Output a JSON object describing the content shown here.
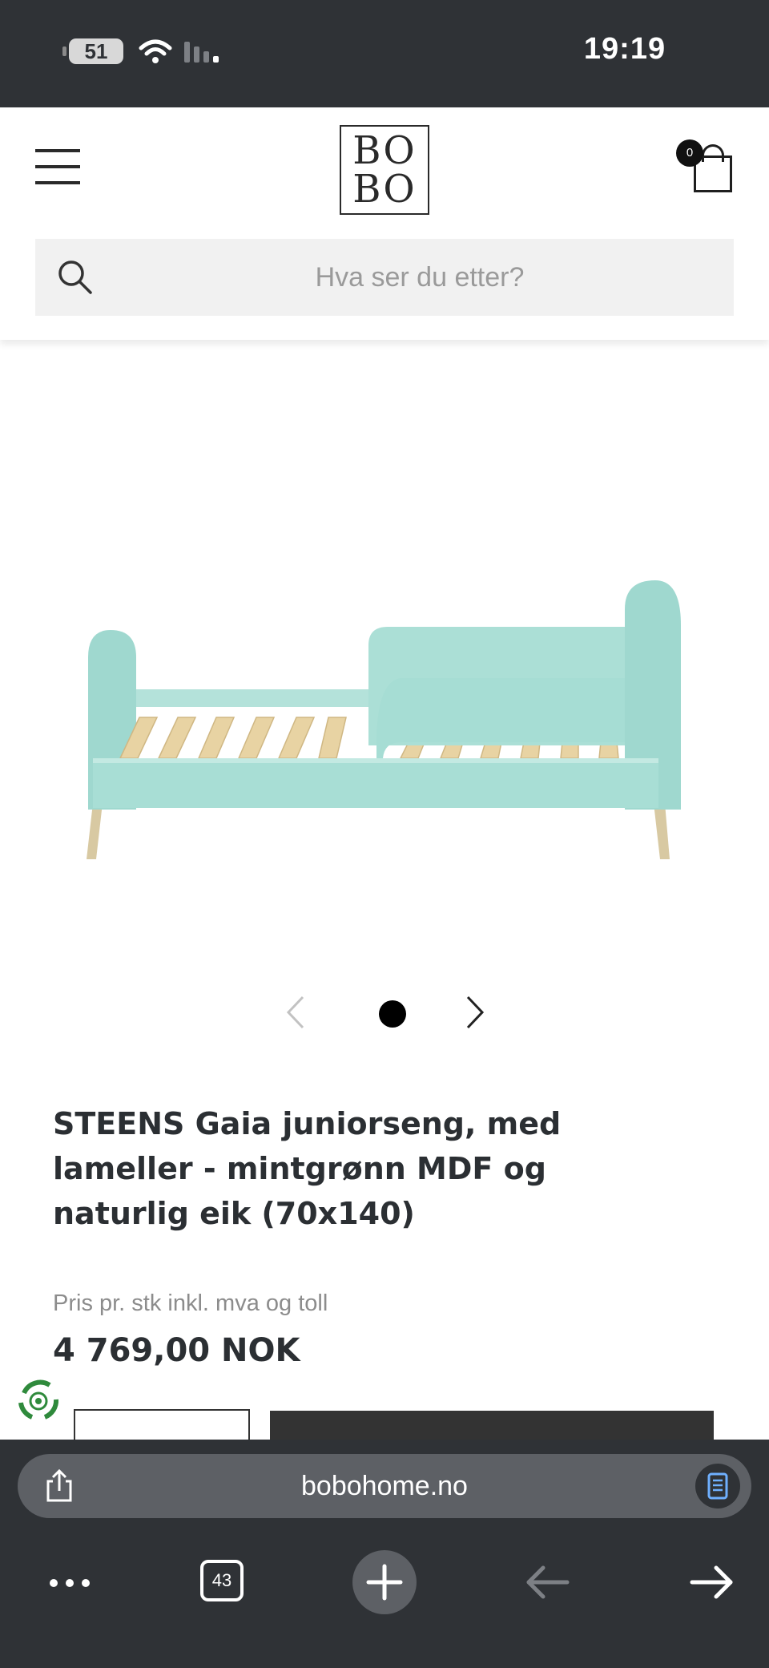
{
  "status_bar": {
    "battery": "51",
    "time": "19:19"
  },
  "header": {
    "logo_line1": "BO",
    "logo_line2": "BO",
    "cart_count": "0",
    "search_placeholder": "Hva ser du etter?"
  },
  "product": {
    "title": "STEENS Gaia juniorseng, med lameller - mintgrønn MDF og naturlig eik (70x140)",
    "price_label": "Pris pr. stk inkl. mva og toll",
    "price": "4 769,00 NOK",
    "image_colors": {
      "bed": "#a6ddd4",
      "slats": "#e8d3a3",
      "legs": "#d8c9a2"
    }
  },
  "browser": {
    "url": "bobohome.no",
    "tab_count": "43"
  },
  "colors": {
    "chrome": "#2f3236",
    "url_bar": "#5d6065",
    "text_dark": "#2b2f33",
    "text_muted": "#8c8c8c"
  }
}
